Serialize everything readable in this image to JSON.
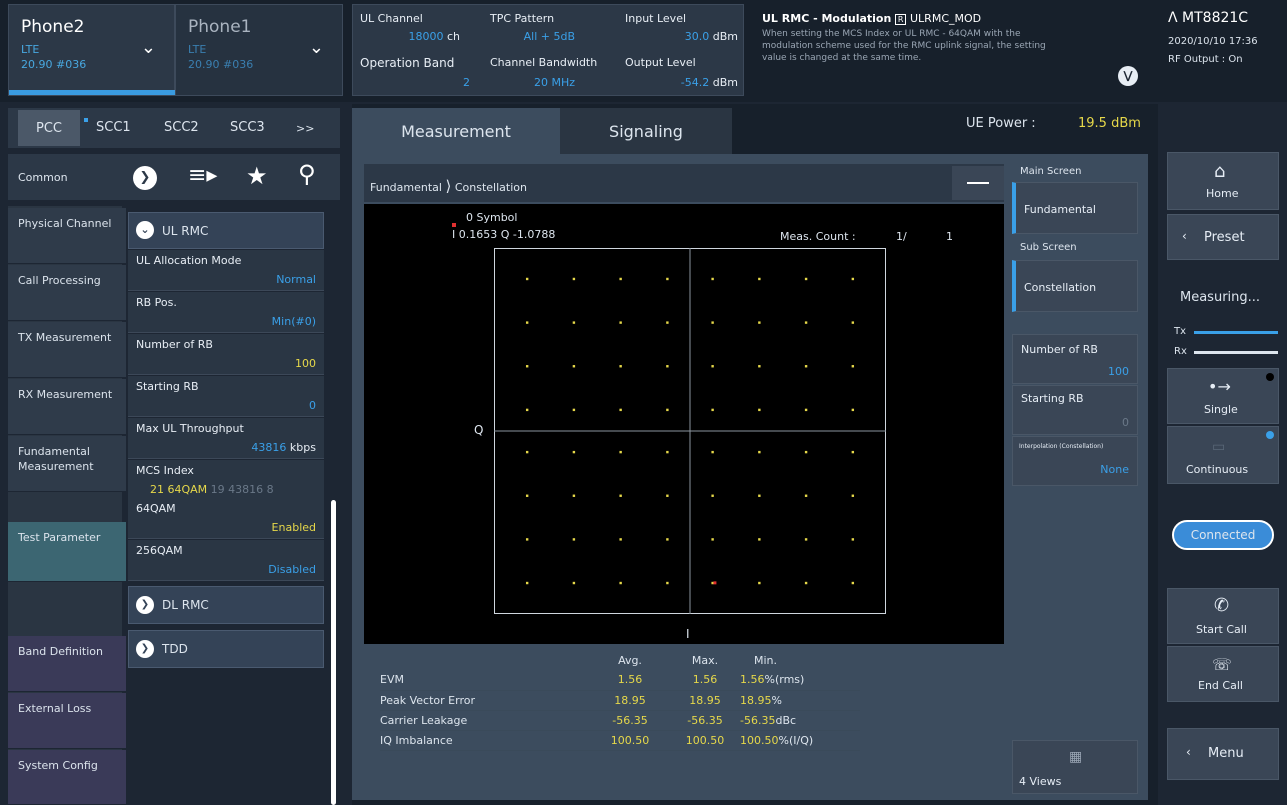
{
  "phone2": {
    "name": "Phone2",
    "tech": "LTE",
    "channel": "20.90 #036"
  },
  "phone1": {
    "name": "Phone1",
    "tech": "LTE",
    "channel": "20.90 #036"
  },
  "params": {
    "ul_channel_lbl": "UL Channel",
    "ul_channel_val": "18000",
    "ul_channel_unit": "ch",
    "op_band_lbl": "Operation Band",
    "op_band_val": "2",
    "tpc_lbl": "TPC Pattern",
    "tpc_val": "All + 5dB",
    "chbw_lbl": "Channel Bandwidth",
    "chbw_val": "20 MHz",
    "in_lvl_lbl": "Input Level",
    "in_lvl_val": "30.0",
    "in_lvl_unit": "dBm",
    "out_lvl_lbl": "Output Level",
    "out_lvl_val": "-54.2",
    "out_lvl_unit": "dBm"
  },
  "info": {
    "title": "UL RMC - Modulation",
    "code": "ULRMC_MOD",
    "text1": "When setting the MCS Index or UL RMC - 64QAM with the",
    "text2": "modulation scheme used for the RMC uplink signal, the setting",
    "text3": "value is changed at the same time."
  },
  "device": {
    "model": "MT8821C",
    "datetime": "2020/10/10 17:36",
    "rf": "RF Output : On"
  },
  "cc_tabs": [
    "PCC",
    "SCC1",
    "SCC2",
    "SCC3",
    ">>"
  ],
  "main_tabs": {
    "measurement": "Measurement",
    "signaling": "Signaling"
  },
  "ue_power": {
    "label": "UE Power :",
    "value": "19.5 dBm"
  },
  "common_label": "Common",
  "left_menu": [
    "Physical Channel",
    "Call Processing",
    "TX Measurement",
    "RX Measurement",
    "Fundamental Measurement",
    "Test Parameter",
    "Band Definition",
    "External Loss",
    "System Config"
  ],
  "ul_rmc": {
    "title": "UL RMC",
    "items": [
      {
        "label": "UL Allocation Mode",
        "value": "Normal"
      },
      {
        "label": "RB Pos.",
        "value": "Min(#0)"
      },
      {
        "label": "Number of RB",
        "value": "100"
      },
      {
        "label": "Starting RB",
        "value": "0"
      },
      {
        "label": "Max UL Throughput",
        "value": "43816",
        "unit": "kbps"
      },
      {
        "label": "MCS Index",
        "value": "21  64QAM",
        "extra": "19  43816  8"
      },
      {
        "label": "64QAM",
        "value": "Enabled"
      },
      {
        "label": "256QAM",
        "value": "Disabled"
      }
    ]
  },
  "dl_rmc": "DL RMC",
  "tdd": "TDD",
  "breadcrumb": {
    "a": "Fundamental",
    "b": "Constellation"
  },
  "marker": {
    "title": "0 Symbol",
    "value": "I 0.1653 Q -1.0788"
  },
  "meas_count": {
    "label": "Meas. Count :",
    "value": "1/",
    "total": "1"
  },
  "axis": {
    "x": "I",
    "y": "Q"
  },
  "chart_data": {
    "type": "scatter",
    "x_range": [
      -1.3,
      1.3
    ],
    "y_range": [
      -1.3,
      1.3
    ],
    "points_i": [
      -1.08,
      -0.77,
      -0.46,
      -0.15,
      0.15,
      0.46,
      0.77,
      1.08
    ],
    "points_q": [
      -1.08,
      -0.77,
      -0.46,
      -0.15,
      0.15,
      0.46,
      0.77,
      1.08
    ],
    "marker": [
      0.1653,
      -1.0788
    ]
  },
  "results": {
    "headers": [
      "Avg.",
      "Max.",
      "Min."
    ],
    "rows": [
      {
        "name": "EVM",
        "avg": "1.56",
        "max": "1.56",
        "min": "1.56",
        "unit": "%(rms)"
      },
      {
        "name": "Peak Vector Error",
        "avg": "18.95",
        "max": "18.95",
        "min": "18.95",
        "unit": "%"
      },
      {
        "name": "Carrier Leakage",
        "avg": "-56.35",
        "max": "-56.35",
        "min": "-56.35",
        "unit": "dBc"
      },
      {
        "name": "IQ Imbalance",
        "avg": "100.50",
        "max": "100.50",
        "min": "100.50",
        "unit": "%(I/Q)"
      }
    ]
  },
  "screens": {
    "main_lbl": "Main Screen",
    "main_val": "Fundamental",
    "sub_lbl": "Sub Screen",
    "sub_val": "Constellation",
    "nrb_lbl": "Number of RB",
    "nrb_val": "100",
    "srb_lbl": "Starting RB",
    "srb_val": "0",
    "interp_lbl": "Interpolation (Constellation)",
    "interp_val": "None",
    "views": "4 Views"
  },
  "right_panel": {
    "home": "Home",
    "preset": "Preset",
    "measuring": "Measuring...",
    "tx": "Tx",
    "rx": "Rx",
    "single": "Single",
    "continuous": "Continuous",
    "connected": "Connected",
    "start_call": "Start Call",
    "end_call": "End Call",
    "menu": "Menu"
  }
}
